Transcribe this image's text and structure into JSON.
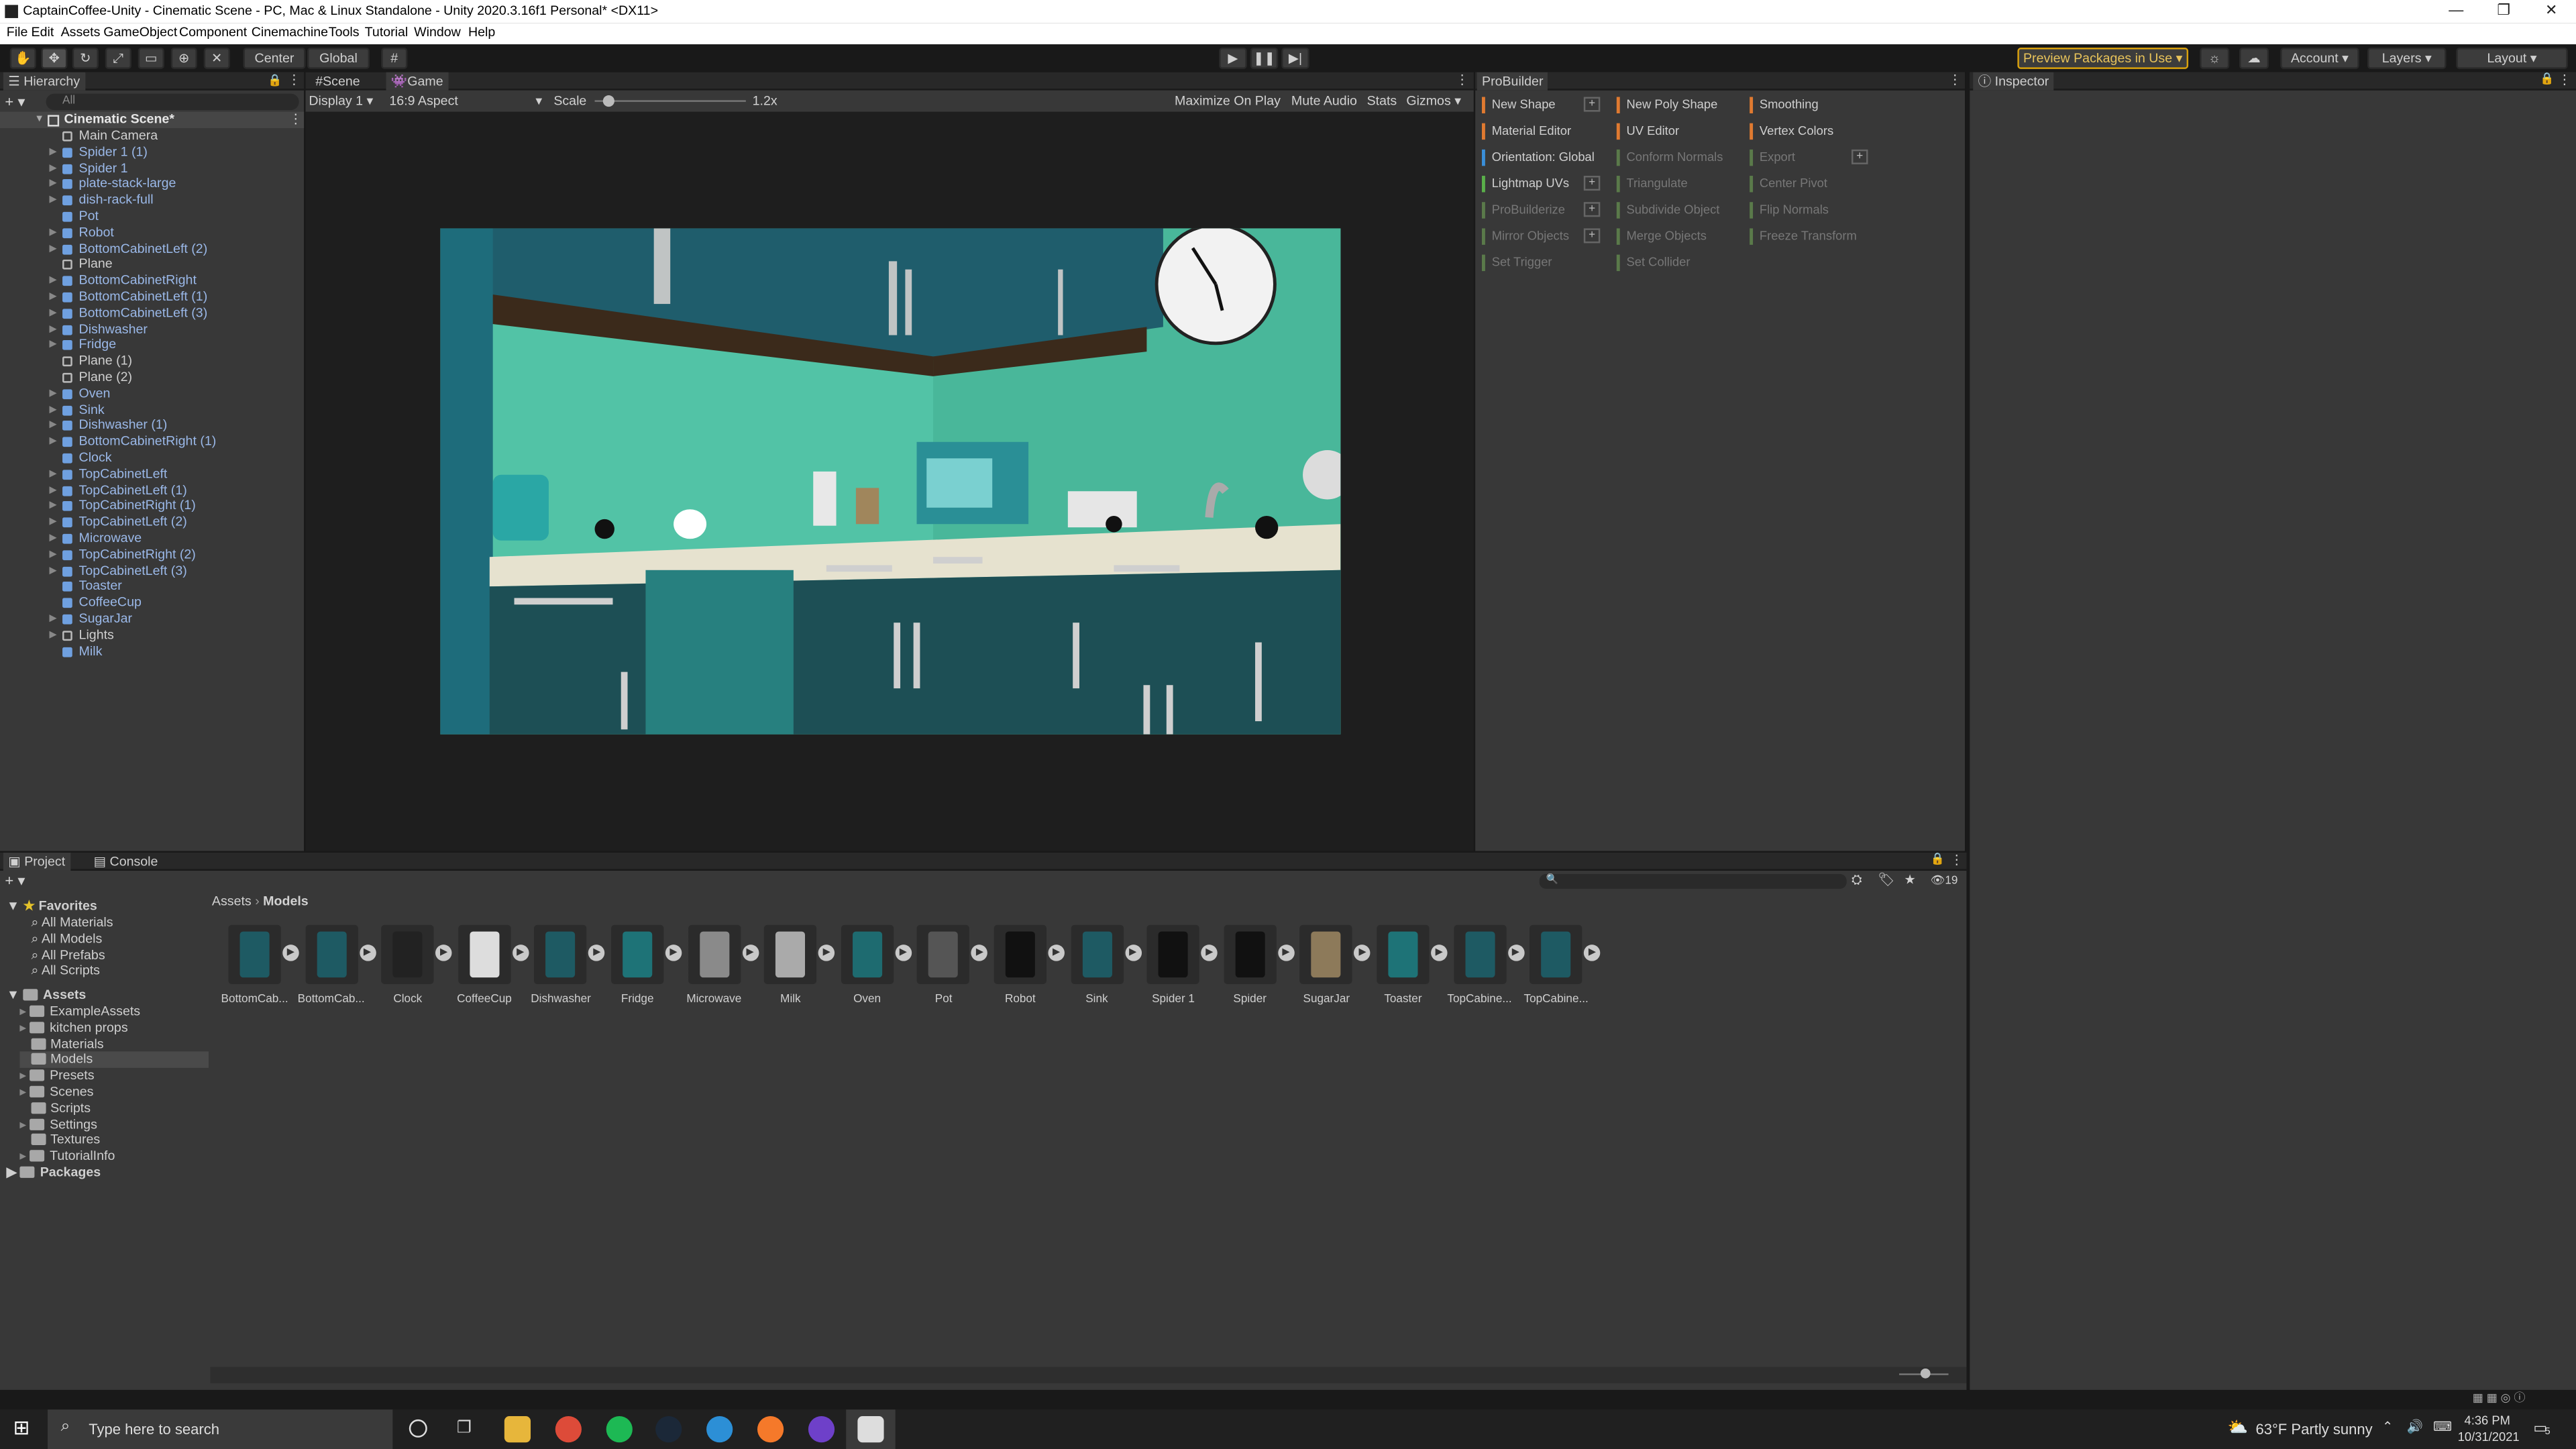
{
  "window": {
    "title": "CaptainCoffee-Unity - Cinematic Scene - PC, Mac & Linux Standalone - Unity 2020.3.16f1 Personal* <DX11>"
  },
  "menu": [
    "File",
    "Edit",
    "Assets",
    "GameObject",
    "Component",
    "Cinemachine",
    "Tools",
    "Tutorial",
    "Window",
    "Help"
  ],
  "toolbar": {
    "pivot": "Center",
    "space": "Global",
    "preview_packages": "Preview Packages in Use",
    "account": "Account",
    "layers": "Layers",
    "layout": "Layout"
  },
  "hierarchy": {
    "tab": "Hierarchy",
    "search_placeholder": "All",
    "scene": "Cinematic Scene*",
    "items": [
      {
        "label": "Main Camera",
        "type": "go",
        "expand": false
      },
      {
        "label": "Spider 1 (1)",
        "type": "prefab",
        "expand": true
      },
      {
        "label": "Spider 1",
        "type": "prefab",
        "expand": true
      },
      {
        "label": "plate-stack-large",
        "type": "prefab",
        "expand": true
      },
      {
        "label": "dish-rack-full",
        "type": "prefab",
        "expand": true
      },
      {
        "label": "Pot",
        "type": "prefab",
        "expand": false
      },
      {
        "label": "Robot",
        "type": "prefab",
        "expand": true
      },
      {
        "label": "BottomCabinetLeft (2)",
        "type": "prefab",
        "expand": true
      },
      {
        "label": "Plane",
        "type": "go",
        "expand": false
      },
      {
        "label": "BottomCabinetRight",
        "type": "prefab",
        "expand": true
      },
      {
        "label": "BottomCabinetLeft (1)",
        "type": "prefab",
        "expand": true
      },
      {
        "label": "BottomCabinetLeft (3)",
        "type": "prefab",
        "expand": true
      },
      {
        "label": "Dishwasher",
        "type": "prefab",
        "expand": true
      },
      {
        "label": "Fridge",
        "type": "prefab",
        "expand": true
      },
      {
        "label": "Plane (1)",
        "type": "go",
        "expand": false
      },
      {
        "label": "Plane (2)",
        "type": "go",
        "expand": false
      },
      {
        "label": "Oven",
        "type": "prefab",
        "expand": true
      },
      {
        "label": "Sink",
        "type": "prefab",
        "expand": true
      },
      {
        "label": "Dishwasher (1)",
        "type": "prefab",
        "expand": true
      },
      {
        "label": "BottomCabinetRight (1)",
        "type": "prefab",
        "expand": true
      },
      {
        "label": "Clock",
        "type": "prefab",
        "expand": false
      },
      {
        "label": "TopCabinetLeft",
        "type": "prefab",
        "expand": true
      },
      {
        "label": "TopCabinetLeft (1)",
        "type": "prefab",
        "expand": true
      },
      {
        "label": "TopCabinetRight (1)",
        "type": "prefab",
        "expand": true
      },
      {
        "label": "TopCabinetLeft (2)",
        "type": "prefab",
        "expand": true
      },
      {
        "label": "Microwave",
        "type": "prefab",
        "expand": true
      },
      {
        "label": "TopCabinetRight (2)",
        "type": "prefab",
        "expand": true
      },
      {
        "label": "TopCabinetLeft (3)",
        "type": "prefab",
        "expand": true
      },
      {
        "label": "Toaster",
        "type": "prefab",
        "expand": false
      },
      {
        "label": "CoffeeCup",
        "type": "prefab",
        "expand": false
      },
      {
        "label": "SugarJar",
        "type": "prefab",
        "expand": true
      },
      {
        "label": "Lights",
        "type": "go",
        "expand": true
      },
      {
        "label": "Milk",
        "type": "prefab",
        "expand": false
      }
    ]
  },
  "game_view": {
    "tab_scene": "Scene",
    "tab_game": "Game",
    "display": "Display 1",
    "aspect": "16:9 Aspect",
    "scale_label": "Scale",
    "scale_value": "1.2x",
    "maximize": "Maximize On Play",
    "mute": "Mute Audio",
    "stats": "Stats",
    "gizmos": "Gizmos"
  },
  "probuilder": {
    "tab": "ProBuilder",
    "col1": [
      {
        "label": "New Shape",
        "color": "#e07a30",
        "dim": false,
        "plus": true
      },
      {
        "label": "Material Editor",
        "color": "#e07a30",
        "dim": false,
        "plus": false
      },
      {
        "label": "Orientation: Global",
        "color": "#3a8fd9",
        "dim": false,
        "plus": false
      },
      {
        "label": "Lightmap UVs",
        "color": "#5ab04a",
        "dim": false,
        "plus": true
      },
      {
        "label": "ProBuilderize",
        "color": "#5a7a4a",
        "dim": true,
        "plus": true
      },
      {
        "label": "Mirror Objects",
        "color": "#5a7a4a",
        "dim": true,
        "plus": true
      },
      {
        "label": "Set Trigger",
        "color": "#5a7a4a",
        "dim": true,
        "plus": false
      }
    ],
    "col2": [
      {
        "label": "New Poly Shape",
        "color": "#e07a30",
        "dim": false
      },
      {
        "label": "UV Editor",
        "color": "#e07a30",
        "dim": false
      },
      {
        "label": "Conform Normals",
        "color": "#5a7a4a",
        "dim": true
      },
      {
        "label": "Triangulate",
        "color": "#5a7a4a",
        "dim": true
      },
      {
        "label": "Subdivide Object",
        "color": "#5a7a4a",
        "dim": true
      },
      {
        "label": "Merge Objects",
        "color": "#5a7a4a",
        "dim": true
      },
      {
        "label": "Set Collider",
        "color": "#5a7a4a",
        "dim": true
      }
    ],
    "col3": [
      {
        "label": "Smoothing",
        "color": "#e07a30",
        "dim": false
      },
      {
        "label": "Vertex Colors",
        "color": "#e07a30",
        "dim": false
      },
      {
        "label": "Export",
        "color": "#5a7a4a",
        "dim": true
      },
      {
        "label": "Center Pivot",
        "color": "#5a7a4a",
        "dim": true
      },
      {
        "label": "Flip Normals",
        "color": "#5a7a4a",
        "dim": true
      },
      {
        "label": "Freeze Transform",
        "color": "#5a7a4a",
        "dim": true
      }
    ]
  },
  "inspector": {
    "tab": "Inspector"
  },
  "project": {
    "tab_project": "Project",
    "tab_console": "Console",
    "hidden_count": "19",
    "breadcrumb": [
      "Assets",
      "Models"
    ],
    "favorites": {
      "label": "Favorites",
      "items": [
        "All Materials",
        "All Models",
        "All Prefabs",
        "All Scripts"
      ]
    },
    "assets_root": "Assets",
    "folders": [
      "ExampleAssets",
      "kitchen props",
      "Materials",
      "Models",
      "Presets",
      "Scenes",
      "Scripts",
      "Settings",
      "Textures",
      "TutorialInfo"
    ],
    "packages": "Packages",
    "models": [
      "BottomCab...",
      "BottomCab...",
      "Clock",
      "CoffeeCup",
      "Dishwasher",
      "Fridge",
      "Microwave",
      "Milk",
      "Oven",
      "Pot",
      "Robot",
      "Sink",
      "Spider 1",
      "Spider",
      "SugarJar",
      "Toaster",
      "TopCabine...",
      "TopCabine..."
    ]
  },
  "taskbar": {
    "search_placeholder": "Type here to search",
    "weather": "63°F  Partly sunny",
    "time": "4:36 PM",
    "date": "10/31/2021",
    "notif": "5"
  }
}
